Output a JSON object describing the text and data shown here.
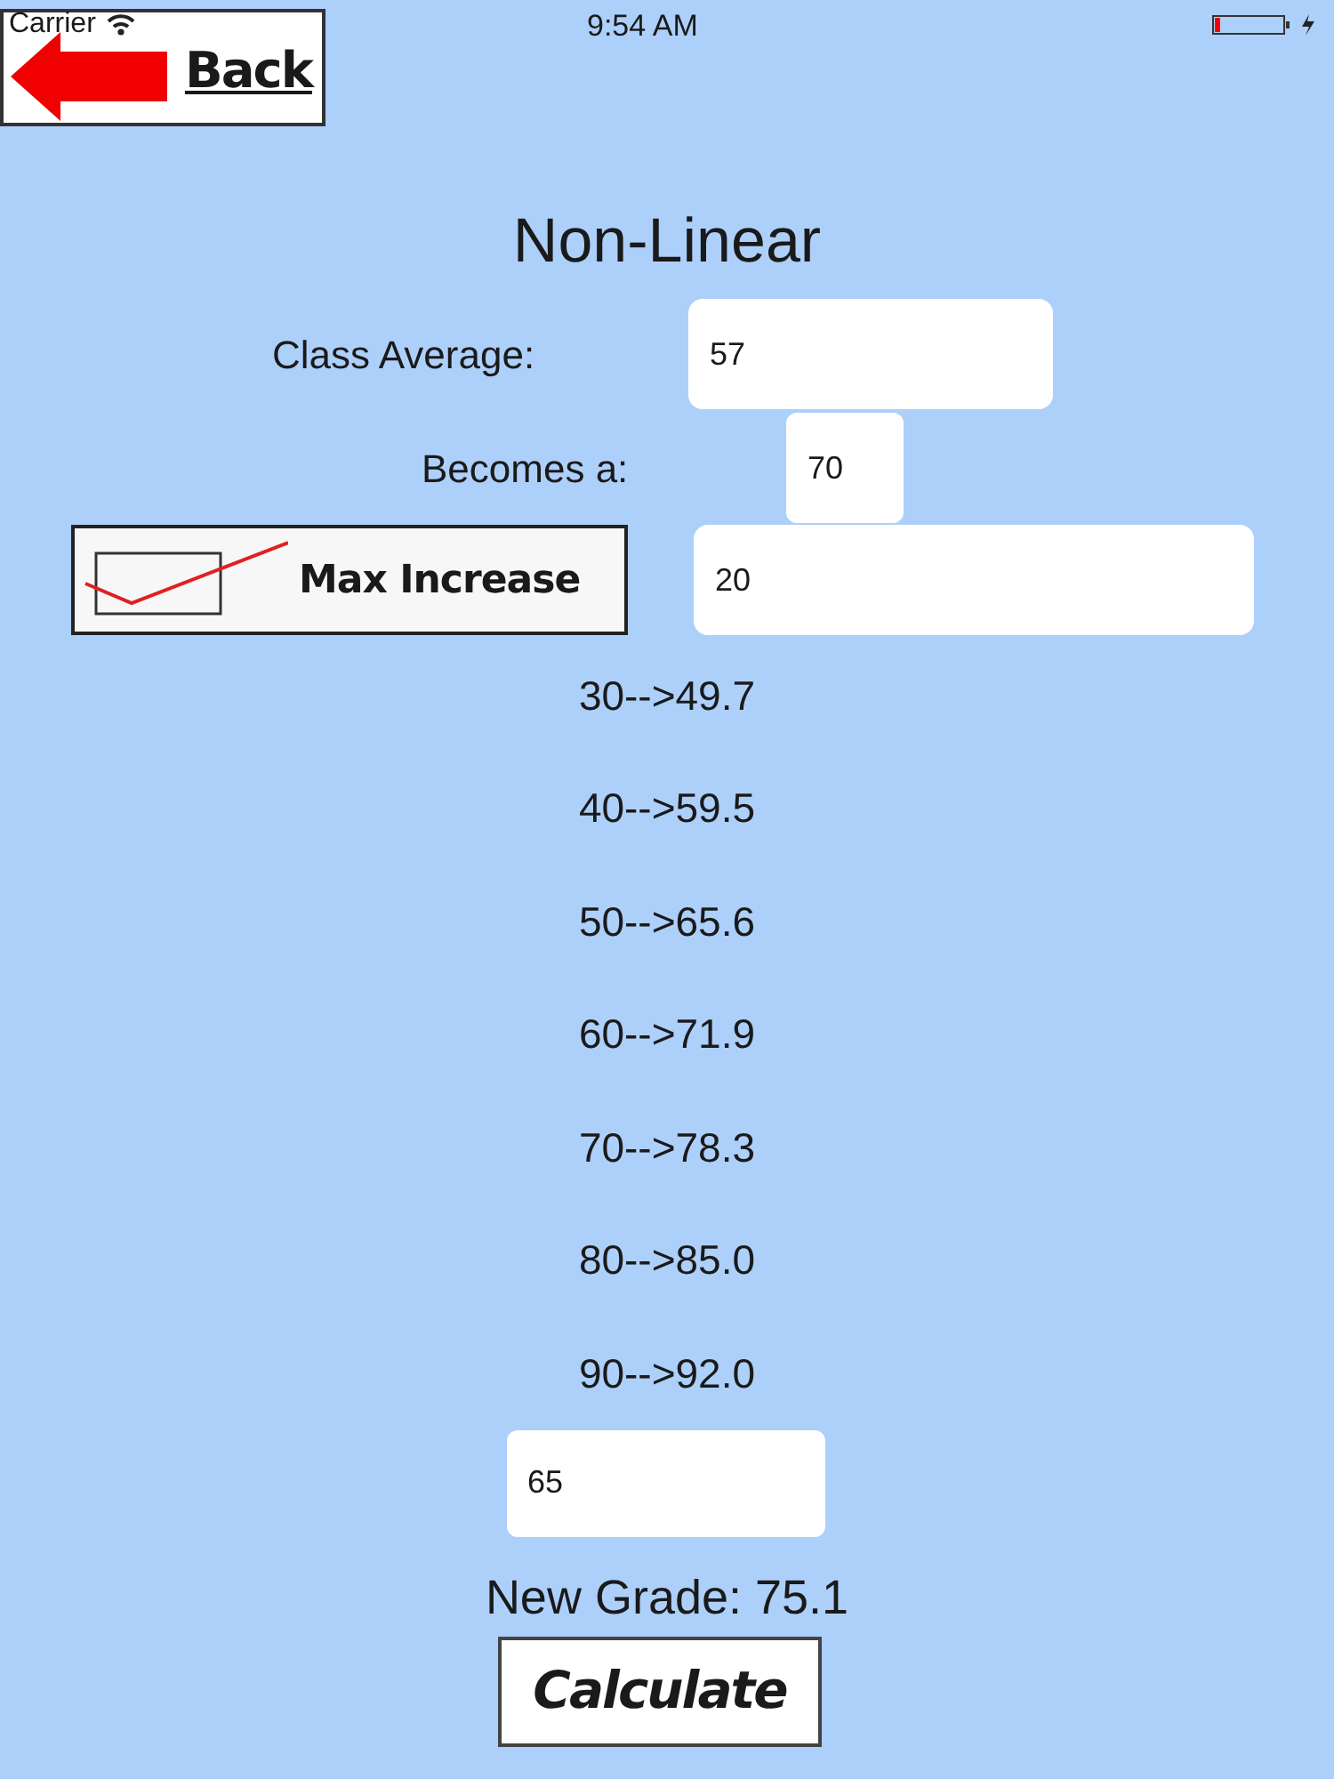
{
  "status_bar": {
    "carrier": "Carrier",
    "time": "9:54 AM"
  },
  "back_button": {
    "label": "Back"
  },
  "title": "Non-Linear",
  "class_average": {
    "label": "Class Average:",
    "value": "57"
  },
  "becomes": {
    "label": "Becomes a:",
    "value": "70"
  },
  "max_increase": {
    "label": "Max Increase",
    "checked": true,
    "value": "20"
  },
  "results": [
    "30-->49.7",
    "40-->59.5",
    "50-->65.6",
    "60-->71.9",
    "70-->78.3",
    "80-->85.0",
    "90-->92.0"
  ],
  "grade_input": {
    "value": "65"
  },
  "new_grade": "New Grade: 75.1",
  "calculate_button": {
    "label": "Calculate"
  }
}
